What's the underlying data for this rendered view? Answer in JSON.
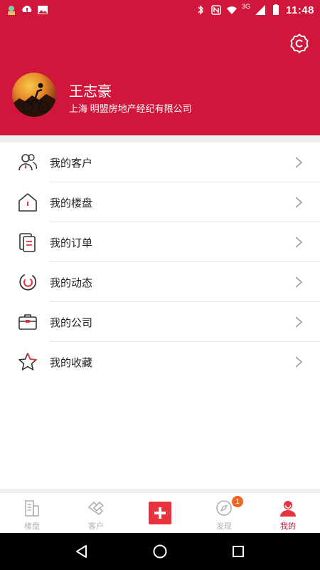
{
  "status_bar": {
    "time": "11:48",
    "network_label": "3G"
  },
  "profile": {
    "name": "王志豪",
    "company": "上海 明盟房地产经纪有限公司"
  },
  "menu": {
    "items": [
      {
        "label": "我的客户",
        "icon": "customers-icon"
      },
      {
        "label": "我的楼盘",
        "icon": "house-icon"
      },
      {
        "label": "我的订单",
        "icon": "order-icon"
      },
      {
        "label": "我的动态",
        "icon": "activity-icon"
      },
      {
        "label": "我的公司",
        "icon": "briefcase-icon"
      },
      {
        "label": "我的收藏",
        "icon": "star-icon"
      }
    ]
  },
  "tabbar": {
    "tabs": [
      {
        "label": "楼盘",
        "icon": "building-icon"
      },
      {
        "label": "客户",
        "icon": "handshake-icon"
      },
      {
        "label": "",
        "icon": "add-icon"
      },
      {
        "label": "发现",
        "icon": "compass-icon",
        "badge": "1"
      },
      {
        "label": "我的",
        "icon": "profile-icon"
      }
    ],
    "active_index": 4
  },
  "colors": {
    "brand": "#d0173b",
    "accent_red": "#e8323e",
    "badge": "#f26522",
    "inactive": "#b0b0b0"
  }
}
